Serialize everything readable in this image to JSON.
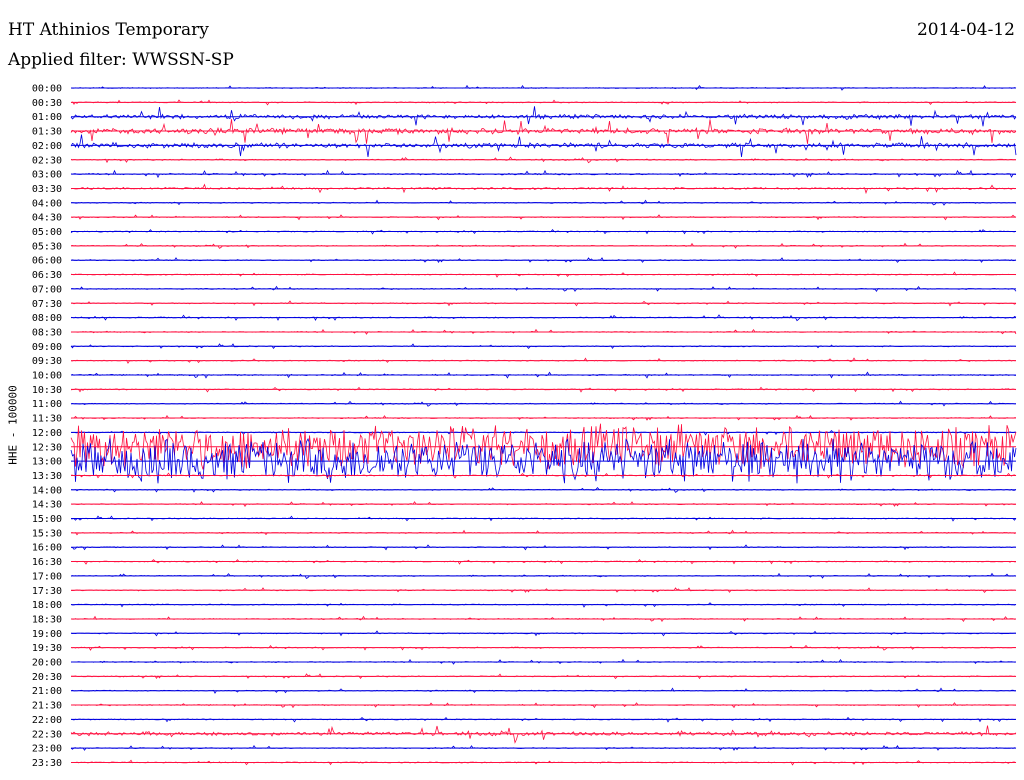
{
  "header": {
    "station": "HT Athinios Temporary",
    "date": "2014-04-12",
    "filter": "Applied filter: WWSSN-SP"
  },
  "axis": {
    "ylabel": "HHE - 100000"
  },
  "colors": {
    "trace_a": "#0000e0",
    "trace_b": "#ff1040",
    "background": "#ffffff",
    "text": "#000000"
  },
  "rows": [
    {
      "time": "00:00",
      "color": "blue",
      "activity": 0.04
    },
    {
      "time": "00:30",
      "color": "red",
      "activity": 0.08
    },
    {
      "time": "01:00",
      "color": "blue",
      "activity": 0.35
    },
    {
      "time": "01:30",
      "color": "red",
      "activity": 0.45
    },
    {
      "time": "02:00",
      "color": "blue",
      "activity": 0.4
    },
    {
      "time": "02:30",
      "color": "red",
      "activity": 0.1
    },
    {
      "time": "03:00",
      "color": "blue",
      "activity": 0.12
    },
    {
      "time": "03:30",
      "color": "red",
      "activity": 0.15
    },
    {
      "time": "04:00",
      "color": "blue",
      "activity": 0.04
    },
    {
      "time": "04:30",
      "color": "red",
      "activity": 0.06
    },
    {
      "time": "05:00",
      "color": "blue",
      "activity": 0.03
    },
    {
      "time": "05:30",
      "color": "red",
      "activity": 0.04
    },
    {
      "time": "06:00",
      "color": "blue",
      "activity": 0.06
    },
    {
      "time": "06:30",
      "color": "red",
      "activity": 0.05
    },
    {
      "time": "07:00",
      "color": "blue",
      "activity": 0.03
    },
    {
      "time": "07:30",
      "color": "red",
      "activity": 0.05
    },
    {
      "time": "08:00",
      "color": "blue",
      "activity": 0.1
    },
    {
      "time": "08:30",
      "color": "red",
      "activity": 0.08
    },
    {
      "time": "09:00",
      "color": "blue",
      "activity": 0.03
    },
    {
      "time": "09:30",
      "color": "red",
      "activity": 0.07
    },
    {
      "time": "10:00",
      "color": "blue",
      "activity": 0.1
    },
    {
      "time": "10:30",
      "color": "red",
      "activity": 0.04
    },
    {
      "time": "11:00",
      "color": "blue",
      "activity": 0.04
    },
    {
      "time": "11:30",
      "color": "red",
      "activity": 0.04
    },
    {
      "time": "12:00",
      "color": "blue",
      "activity": 0.03
    },
    {
      "time": "12:30",
      "color": "red",
      "activity": 1.0
    },
    {
      "time": "13:00",
      "color": "blue",
      "activity": 1.0
    },
    {
      "time": "13:30",
      "color": "red",
      "activity": 0.05
    },
    {
      "time": "14:00",
      "color": "blue",
      "activity": 0.03
    },
    {
      "time": "14:30",
      "color": "red",
      "activity": 0.03
    },
    {
      "time": "15:00",
      "color": "blue",
      "activity": 0.03
    },
    {
      "time": "15:30",
      "color": "red",
      "activity": 0.03
    },
    {
      "time": "16:00",
      "color": "blue",
      "activity": 0.06
    },
    {
      "time": "16:30",
      "color": "red",
      "activity": 0.05
    },
    {
      "time": "17:00",
      "color": "blue",
      "activity": 0.04
    },
    {
      "time": "17:30",
      "color": "red",
      "activity": 0.06
    },
    {
      "time": "18:00",
      "color": "blue",
      "activity": 0.05
    },
    {
      "time": "18:30",
      "color": "red",
      "activity": 0.06
    },
    {
      "time": "19:00",
      "color": "blue",
      "activity": 0.07
    },
    {
      "time": "19:30",
      "color": "red",
      "activity": 0.04
    },
    {
      "time": "20:00",
      "color": "blue",
      "activity": 0.04
    },
    {
      "time": "20:30",
      "color": "red",
      "activity": 0.05
    },
    {
      "time": "21:00",
      "color": "blue",
      "activity": 0.04
    },
    {
      "time": "21:30",
      "color": "red",
      "activity": 0.04
    },
    {
      "time": "22:00",
      "color": "blue",
      "activity": 0.06
    },
    {
      "time": "22:30",
      "color": "red",
      "activity": 0.3
    },
    {
      "time": "23:00",
      "color": "blue",
      "activity": 0.06
    },
    {
      "time": "23:30",
      "color": "red",
      "activity": 0.08
    }
  ]
}
